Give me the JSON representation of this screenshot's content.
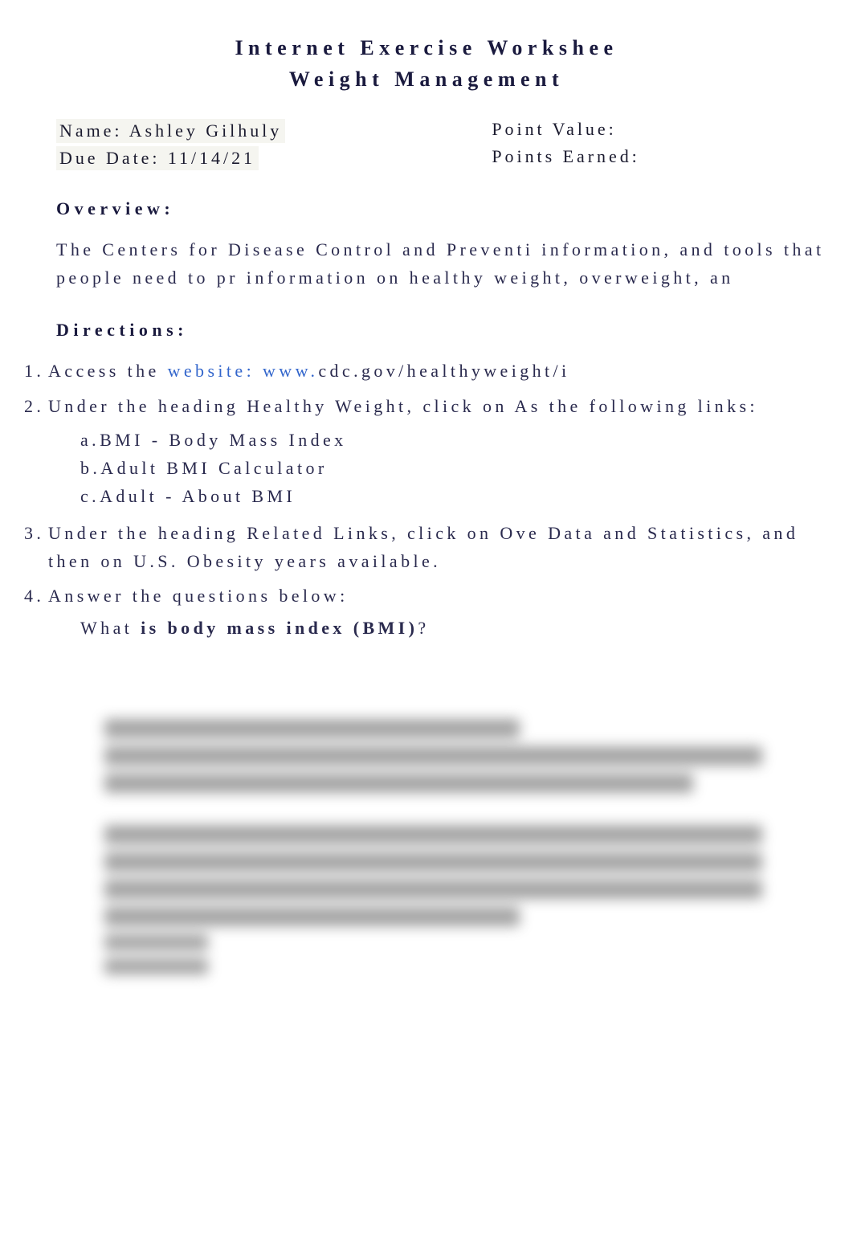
{
  "title": {
    "line1": "Internet Exercise Workshee",
    "line2": "Weight Management"
  },
  "info": {
    "name_label": "Name:",
    "name_value": "Ashley Gilhuly",
    "due_date_label": "Due Date:",
    "due_date_value": "11/14/21",
    "point_value_label": "Point Value:",
    "points_earned_label": "Points Earned:"
  },
  "overview": {
    "heading": "Overview:",
    "text": "The Centers for Disease Control and Preventi information, and tools that people need to pr information on healthy weight, overweight, an"
  },
  "directions": {
    "heading": "Directions:",
    "items": [
      {
        "number": "1.",
        "text_prefix": "Access the ",
        "link_text": "website: www.",
        "text_suffix": "cdc.gov/healthyweight/i"
      },
      {
        "number": "2.",
        "text": "Under the heading Healthy Weight, click on As the following links:",
        "subitems": [
          "a.BMI - Body Mass Index",
          "b.Adult BMI Calculator",
          "c.Adult - About BMI"
        ]
      },
      {
        "number": "3.",
        "text": "Under the heading Related Links, click on Ove Data and Statistics, and then on U.S. Obesity years available."
      },
      {
        "number": "4.",
        "text": "Answer the questions below:",
        "question_prefix": "What ",
        "question_bold": "body mass index (BMI)",
        "question_mid": "is"
      }
    ]
  }
}
